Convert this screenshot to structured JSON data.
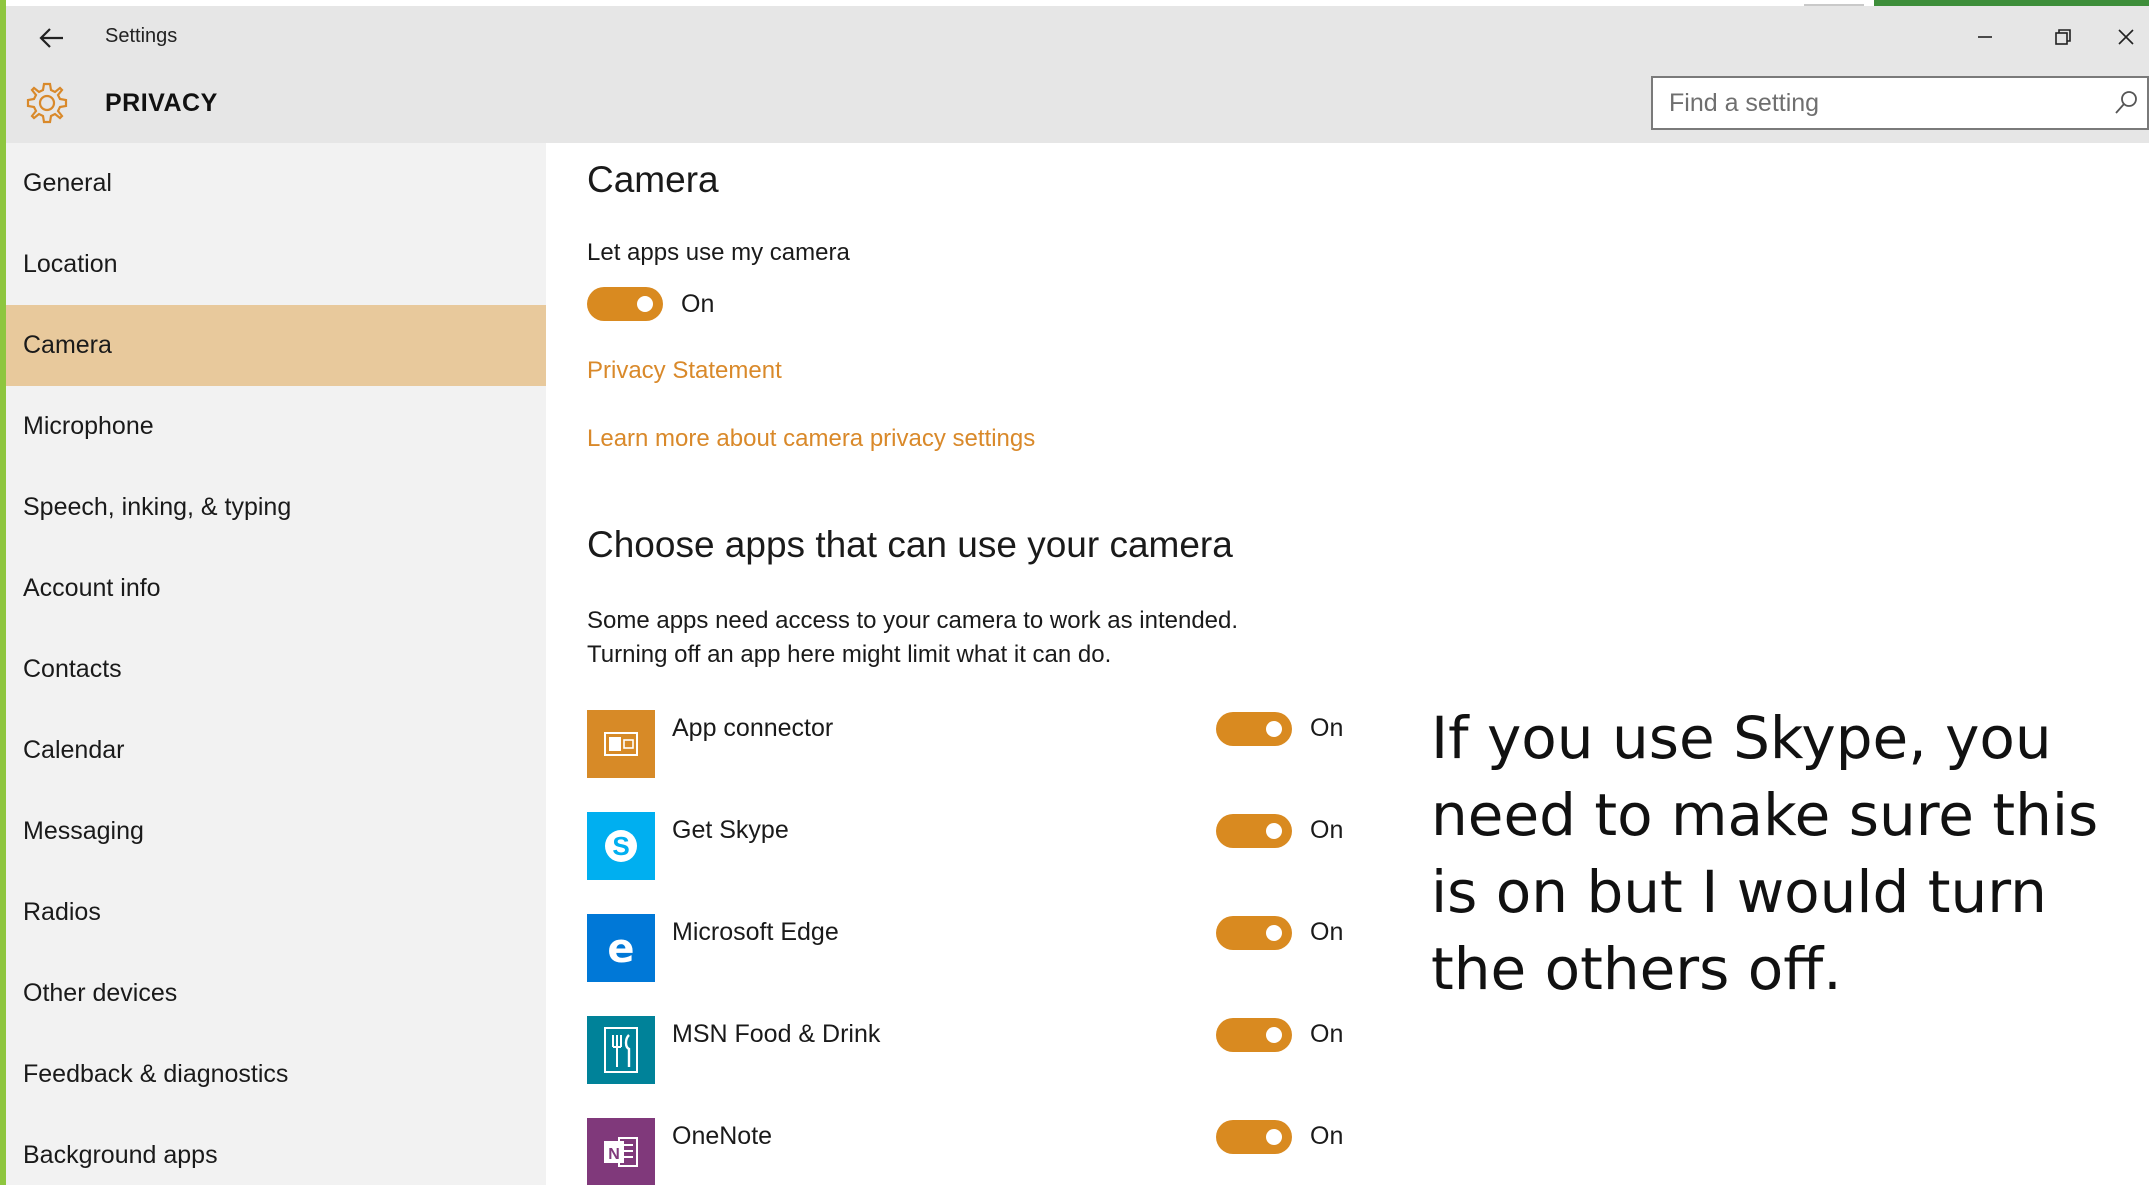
{
  "window": {
    "title": "Settings",
    "back_icon": "back-arrow-icon",
    "controls": [
      "minimize-icon",
      "restore-icon",
      "close-icon"
    ]
  },
  "header": {
    "icon": "gear-icon",
    "title": "PRIVACY",
    "search_placeholder": "Find a setting",
    "search_icon": "search-icon"
  },
  "sidebar": {
    "items": [
      {
        "label": "General"
      },
      {
        "label": "Location"
      },
      {
        "label": "Camera",
        "active": true
      },
      {
        "label": "Microphone"
      },
      {
        "label": "Speech, inking, & typing"
      },
      {
        "label": "Account info"
      },
      {
        "label": "Contacts"
      },
      {
        "label": "Calendar"
      },
      {
        "label": "Messaging"
      },
      {
        "label": "Radios"
      },
      {
        "label": "Other devices"
      },
      {
        "label": "Feedback & diagnostics"
      },
      {
        "label": "Background apps"
      }
    ]
  },
  "main": {
    "title": "Camera",
    "setting_label": "Let apps use my camera",
    "setting_state": "On",
    "links": [
      "Privacy Statement",
      "Learn more about camera privacy settings"
    ],
    "apps_heading": "Choose apps that can use your camera",
    "apps_desc_line1": "Some apps need access to your camera to work as intended.",
    "apps_desc_line2": "Turning off an app here might limit what it can do.",
    "apps": [
      {
        "name": "App connector",
        "state": "On",
        "icon": "app-connector-icon",
        "color": "#d78a27"
      },
      {
        "name": "Get Skype",
        "state": "On",
        "icon": "skype-icon",
        "color": "#00aff0"
      },
      {
        "name": "Microsoft Edge",
        "state": "On",
        "icon": "edge-icon",
        "color": "#0078d7"
      },
      {
        "name": "MSN Food & Drink",
        "state": "On",
        "icon": "food-drink-icon",
        "color": "#008299"
      },
      {
        "name": "OneNote",
        "state": "On",
        "icon": "onenote-icon",
        "color": "#80397b"
      }
    ]
  },
  "annotation": {
    "text": "If you use Skype, you need to make sure this is on but I would turn the others off."
  },
  "colors": {
    "accent": "#d98a20",
    "link": "#d9892a",
    "selected_nav": "#e8c99c",
    "sidebar_bg": "#f2f2f2",
    "titlebar_bg": "#e6e6e6"
  }
}
